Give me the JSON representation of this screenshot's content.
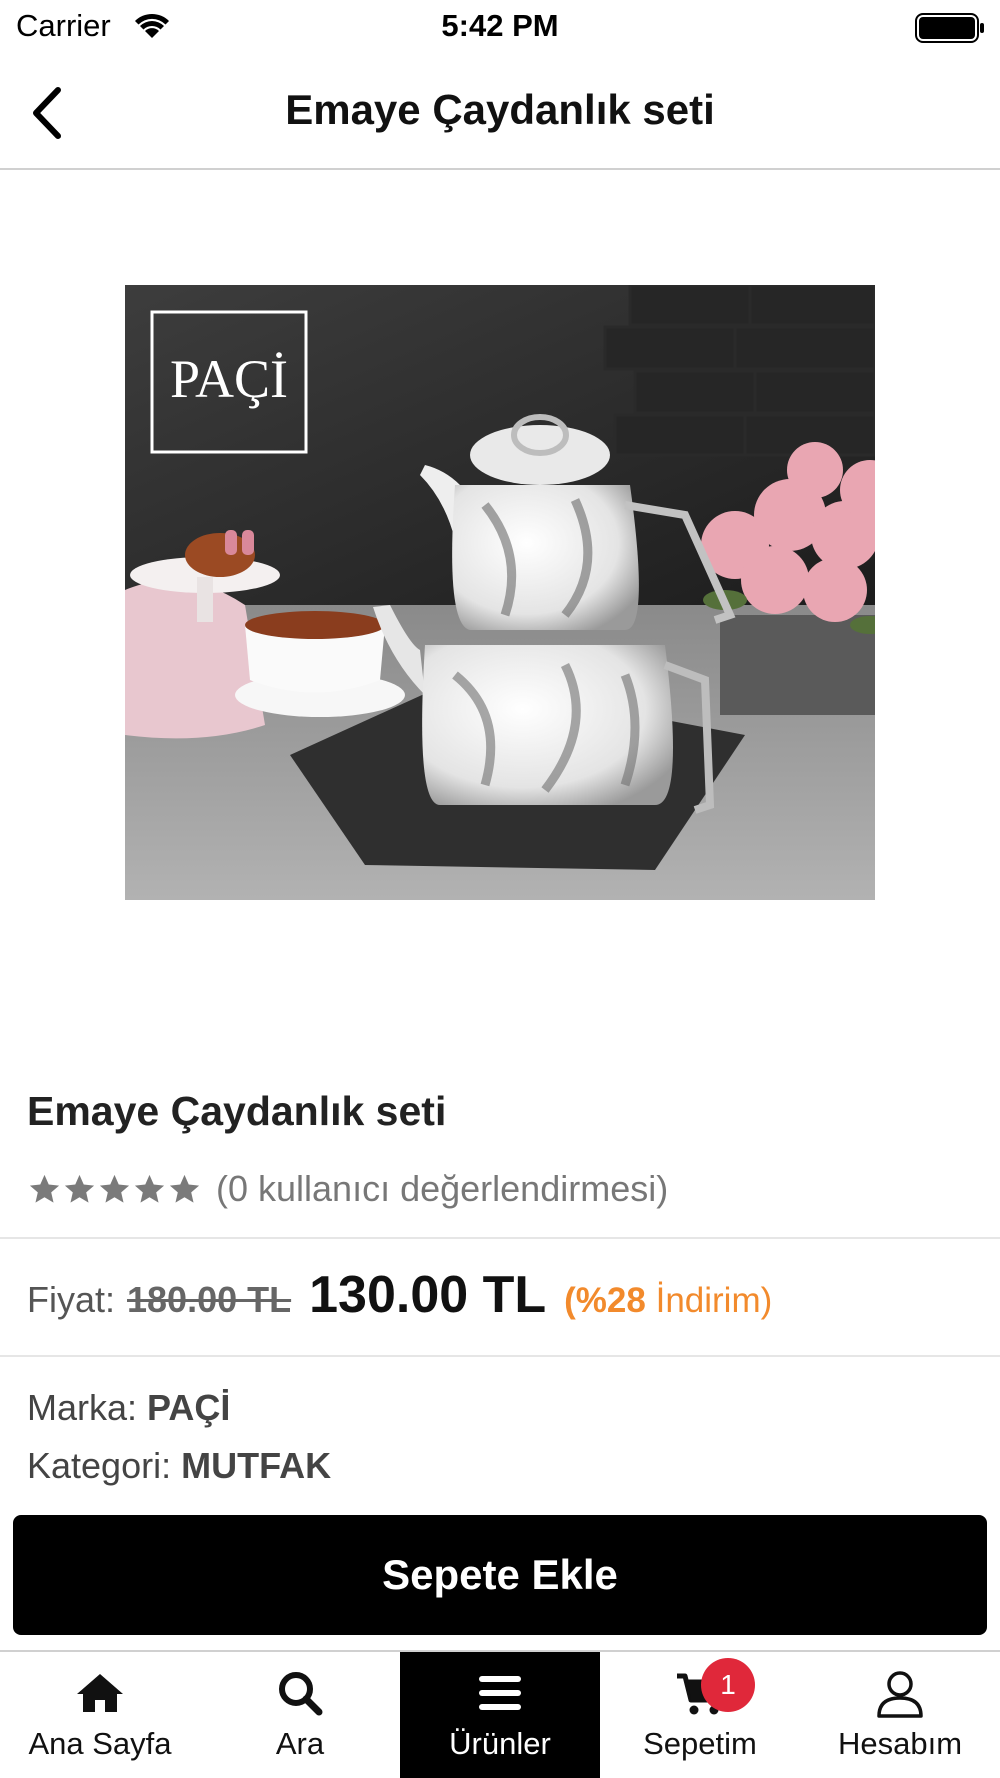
{
  "status_bar": {
    "carrier": "Carrier",
    "time": "5:42 PM",
    "icons": [
      "wifi-icon",
      "battery-icon"
    ]
  },
  "nav": {
    "title": "Emaye Çaydanlık seti",
    "back_icon": "chevron-left-icon"
  },
  "product": {
    "image_logo_text": "PAÇİ",
    "name": "Emaye Çaydanlık seti",
    "rating": {
      "stars": 5,
      "filled": 0,
      "text": "(0 kullanıcı değerlendirmesi)"
    },
    "price": {
      "label": "Fiyat:",
      "old": "180.00 TL",
      "new": "130.00 TL",
      "discount_percent": "(%28",
      "discount_word": "İndirim)"
    },
    "brand": {
      "label": "Marka:",
      "value": "PAÇİ"
    },
    "category": {
      "label": "Kategori:",
      "value": "MUTFAK"
    },
    "add_to_cart": "Sepete Ekle"
  },
  "colors": {
    "accent_discount": "#f28a2c",
    "button_bg": "#000000",
    "badge_bg": "#e0283a",
    "star_empty": "#7a7a7a"
  },
  "tab_bar": {
    "tabs": [
      {
        "label": "Ana Sayfa",
        "icon": "home-icon",
        "active": false
      },
      {
        "label": "Ara",
        "icon": "search-icon",
        "active": false
      },
      {
        "label": "Ürünler",
        "icon": "menu-icon",
        "active": true
      },
      {
        "label": "Sepetim",
        "icon": "cart-icon",
        "active": false,
        "badge": "1"
      },
      {
        "label": "Hesabım",
        "icon": "user-icon",
        "active": false
      }
    ]
  }
}
